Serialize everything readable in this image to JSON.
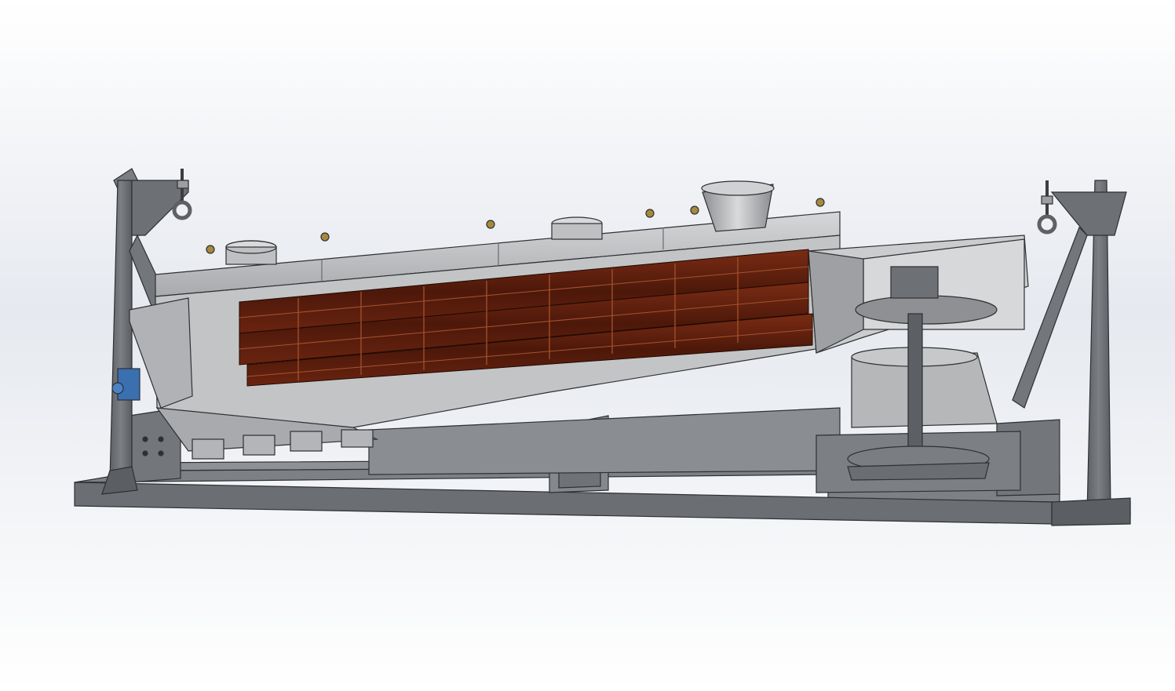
{
  "viewport": {
    "background_top": "#e4e8ef",
    "background_bottom": "#ffffff"
  },
  "model": {
    "frame_color": "#6f7276",
    "frame_dark": "#4d5054",
    "housing_color": "#b8b9bb",
    "housing_light": "#d4d5d7",
    "screen_deck_color": "#5a1e0e",
    "screen_deck_highlight": "#8a3a1e",
    "bolt_color": "#a68a3a",
    "motor_accent": "#3a6fb0",
    "deck_count": 3,
    "inspection_port_count": 2,
    "inlet_count": 1,
    "outlet_count": 5,
    "lifting_eye_count": 2
  }
}
